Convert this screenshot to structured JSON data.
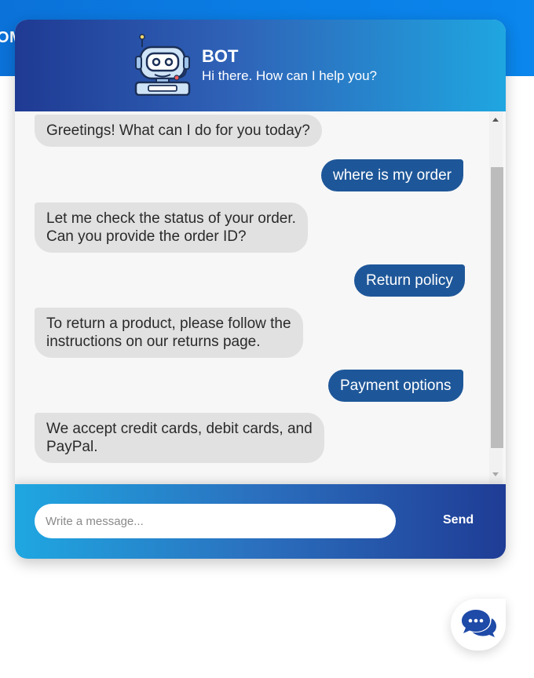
{
  "page": {
    "banner_text": "OM"
  },
  "chat": {
    "header": {
      "title": "BOT",
      "subtitle": "Hi there. How can I help you?",
      "avatar_icon": "robot-icon"
    },
    "messages": [
      {
        "sender": "bot",
        "text": "Greetings! What can I do for you today?"
      },
      {
        "sender": "user",
        "text": "where is my order"
      },
      {
        "sender": "bot",
        "text": "Let me check the status of your order.\nCan you provide the order ID?"
      },
      {
        "sender": "user",
        "text": "Return policy"
      },
      {
        "sender": "bot",
        "text": "To return a product, please follow the\ninstructions on our returns page."
      },
      {
        "sender": "user",
        "text": "Payment options"
      },
      {
        "sender": "bot",
        "text": "We accept credit cards, debit cards, and\nPayPal."
      }
    ],
    "input": {
      "placeholder": "Write a message...",
      "value": ""
    },
    "send_label": "Send"
  },
  "launcher": {
    "icon": "chat-bubbles-icon"
  },
  "colors": {
    "user_bubble": "#1e5799",
    "bot_bubble": "#e1e1e1",
    "header_gradient_start": "#1f3a93",
    "header_gradient_end": "#1fa6e0",
    "launcher_icon": "#1e4aa8"
  }
}
